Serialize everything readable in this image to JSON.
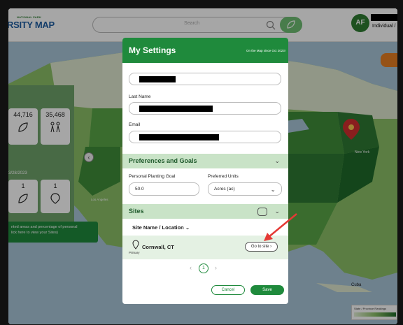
{
  "header": {
    "brand_small": "NATIONAL PARK",
    "brand": "RSITY MAP",
    "search_placeholder": "Search",
    "avatar_initials": "AF",
    "user_label": "Individual /"
  },
  "map_labels": {
    "new_york": "New York",
    "cuba": "Cuba",
    "los_angeles": "Los Angeles"
  },
  "side_panel": {
    "stats_top": [
      "44,716",
      "35,468"
    ],
    "date": "3/28/2023",
    "stats_bottom": [
      "1",
      "1"
    ],
    "info_line1": "nted areas and percentage of personal",
    "info_line2": "lick here to view your Sites)"
  },
  "modal": {
    "title": "My Settings",
    "subtitle": "On the Map since Oct 2023!",
    "last_name_label": "Last Name",
    "email_label": "Email",
    "preferences_title": "Preferences and Goals",
    "goal_label": "Personal Planting Goal",
    "goal_value": "50.0",
    "units_label": "Preferred Units",
    "units_value": "Acres (ac)",
    "sites_title": "Sites",
    "column_header": "Site Name / Location",
    "site_name": "Cornwall, CT",
    "site_tag": "Primary",
    "goto_label": "Go to site",
    "page_current": "1",
    "cancel_label": "Cancel",
    "save_label": "Save"
  },
  "legend": {
    "title": "State / Province Rankings"
  },
  "colors": {
    "brand_green": "#1f8a3c",
    "section_green": "#c9e3c7",
    "arrow_red": "#e53935"
  }
}
